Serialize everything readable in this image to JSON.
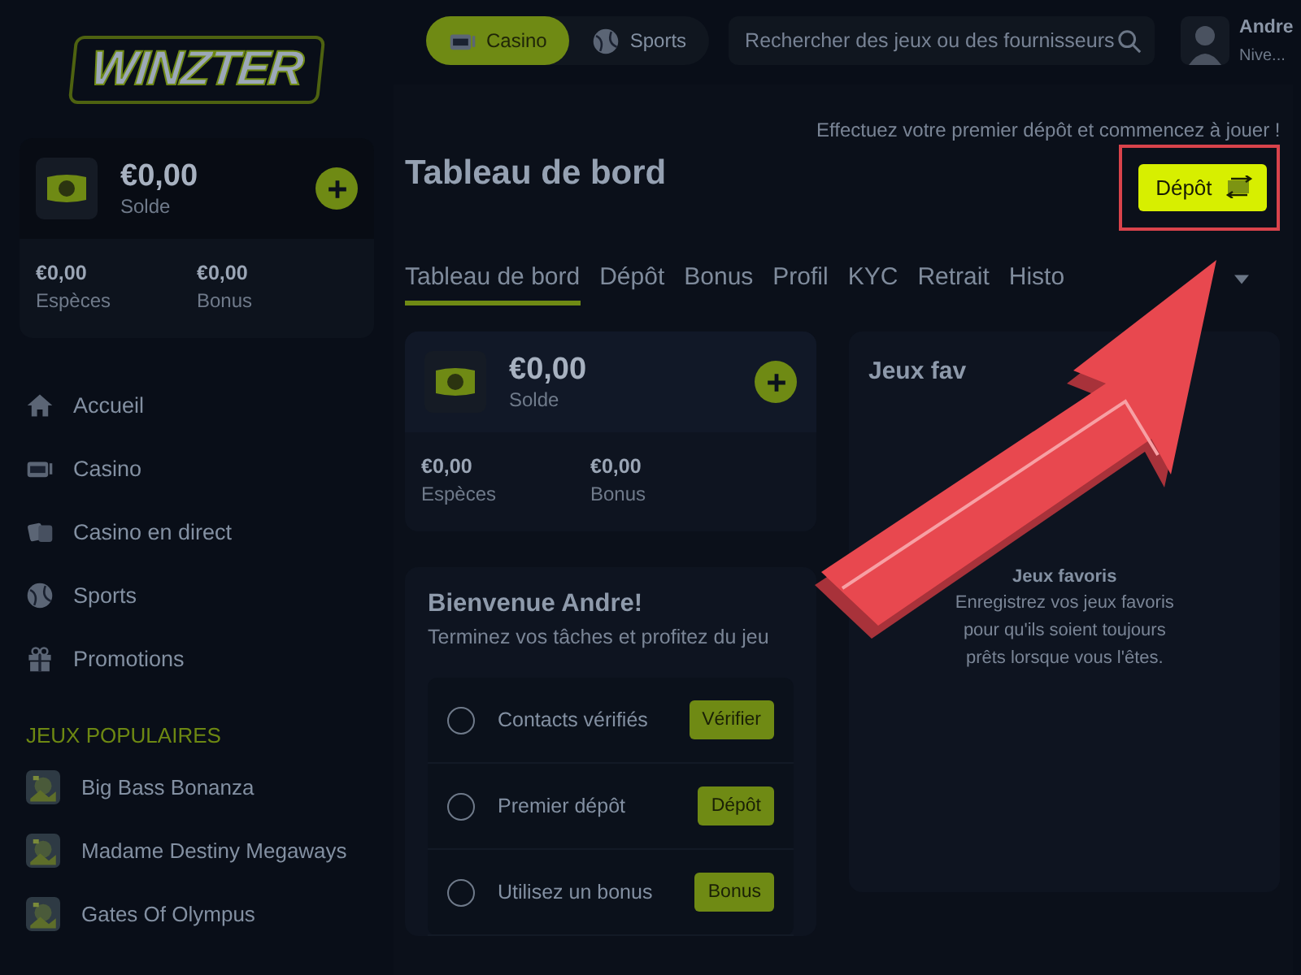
{
  "logo": "WINZTER",
  "top_nav": [
    {
      "label": "Casino",
      "selected": true
    },
    {
      "label": "Sports",
      "selected": false
    }
  ],
  "search": {
    "placeholder": "Rechercher des jeux ou des fournisseurs"
  },
  "user": {
    "name": "Andre",
    "subtitle": "Nive..."
  },
  "sidebar": {
    "balance": {
      "amount": "€0,00",
      "label": "Solde",
      "split": [
        {
          "amount": "€0,00",
          "label": "Espèces"
        },
        {
          "amount": "€0,00",
          "label": "Bonus"
        }
      ]
    },
    "items": [
      {
        "label": "Accueil"
      },
      {
        "label": "Casino"
      },
      {
        "label": "Casino en direct"
      },
      {
        "label": "Sports"
      },
      {
        "label": "Promotions"
      }
    ],
    "section_title": "JEUX POPULAIRES",
    "games": [
      {
        "label": "Big Bass Bonanza",
        "kind": "picture"
      },
      {
        "label": "Madame Destiny Megaways",
        "kind": "picture"
      },
      {
        "label": "Gates Of Olympus",
        "kind": "picture"
      }
    ]
  },
  "page": {
    "title": "Tableau de bord",
    "promo": "Effectuez votre premier dépôt et commencez à jouer !",
    "deposit_button": "Dépôt",
    "tabs": [
      {
        "label": "Tableau de bord",
        "selected": true,
        "dropdown": false
      },
      {
        "label": "Dépôt",
        "selected": false,
        "dropdown": false
      },
      {
        "label": "Bonus",
        "selected": false,
        "dropdown": false
      },
      {
        "label": "Profil",
        "selected": false,
        "dropdown": false
      },
      {
        "label": "KYC",
        "selected": false,
        "dropdown": false
      },
      {
        "label": "Retrait",
        "selected": false,
        "dropdown": false
      },
      {
        "label": "Histo",
        "selected": false,
        "dropdown": true
      }
    ],
    "balance": {
      "amount": "€0,00",
      "label": "Solde",
      "split": [
        {
          "amount": "€0,00",
          "label": "Espèces"
        },
        {
          "amount": "€0,00",
          "label": "Bonus"
        }
      ]
    },
    "welcome": {
      "title": "Bienvenue Andre!",
      "subtitle": "Terminez vos tâches et profitez du jeu",
      "tasks": [
        {
          "label": "Contacts vérifiés",
          "action": "Vérifier",
          "checked": false
        },
        {
          "label": "Premier dépôt",
          "action": "Dépôt",
          "checked": false
        },
        {
          "label": "Utilisez un bonus",
          "action": "Bonus",
          "checked": false
        }
      ]
    },
    "favorites": {
      "title": "Jeux fav",
      "empty_title": "Jeux favoris",
      "empty_text": "Enregistrez vos jeux favoris pour qu'ils soient toujours prêts lorsque vous l'êtes."
    }
  }
}
